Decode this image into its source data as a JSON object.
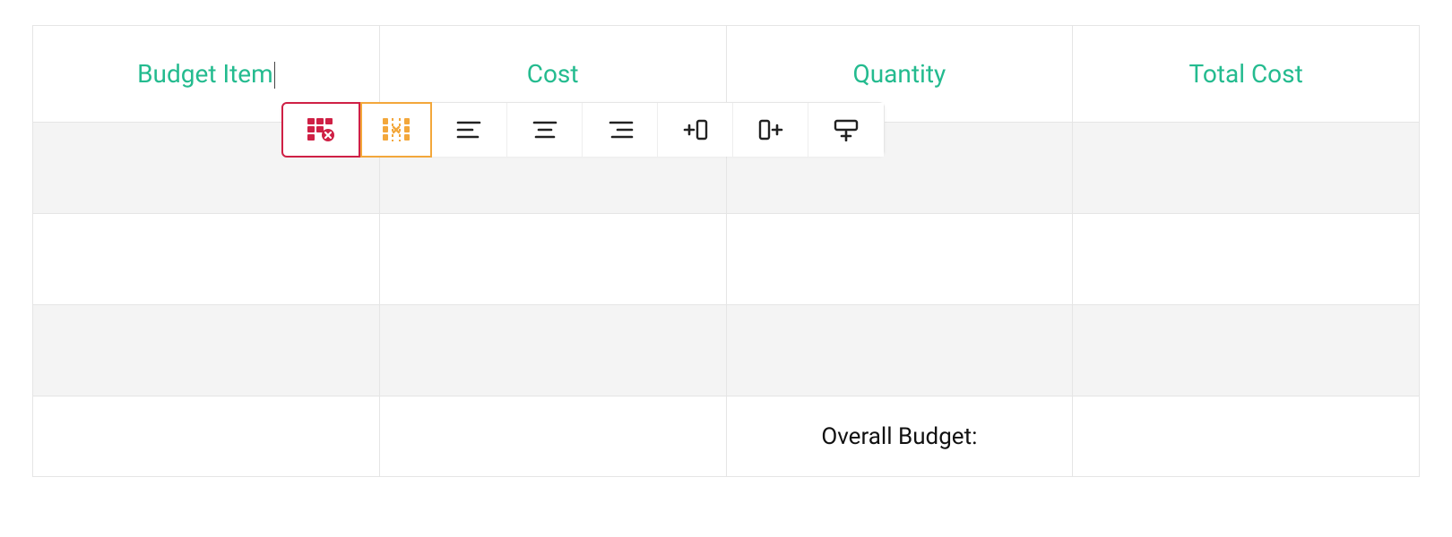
{
  "table": {
    "headers": [
      "Budget Item",
      "Cost",
      "Quantity",
      "Total Cost"
    ],
    "footer_label": "Overall Budget:"
  },
  "toolbar": {
    "items": [
      {
        "name": "delete-table-icon"
      },
      {
        "name": "delete-column-icon"
      },
      {
        "name": "align-left-icon"
      },
      {
        "name": "align-center-icon"
      },
      {
        "name": "align-right-icon"
      },
      {
        "name": "insert-column-left-icon"
      },
      {
        "name": "insert-column-right-icon"
      },
      {
        "name": "insert-row-below-icon"
      }
    ]
  },
  "colors": {
    "accent": "#24bb8f",
    "danger": "#cf2045",
    "warn": "#f3a73b",
    "icon": "#222222"
  }
}
